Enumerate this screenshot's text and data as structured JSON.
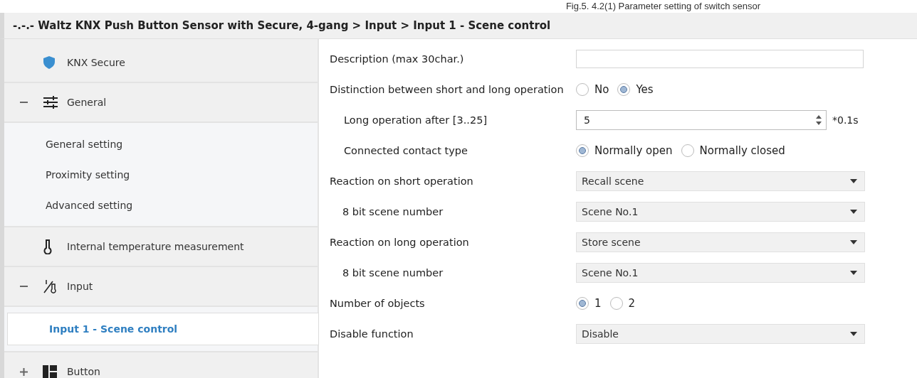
{
  "caption": "Fig.5. 4.2(1) Parameter setting of switch sensor",
  "title": "-.-.- Waltz KNX Push Button Sensor with Secure, 4-gang > Input > Input 1 - Scene control",
  "sidebar": {
    "items": [
      {
        "label": "KNX Secure"
      },
      {
        "label": "General",
        "expanded": true,
        "children": [
          {
            "label": "General setting",
            "selected": false
          },
          {
            "label": "Proximity setting",
            "selected": false
          },
          {
            "label": "Advanced setting",
            "selected": false
          }
        ]
      },
      {
        "label": "Internal temperature measurement"
      },
      {
        "label": "Input",
        "expanded": true,
        "children": [
          {
            "label": "Input 1 - Scene control",
            "selected": true
          }
        ]
      },
      {
        "label": "Button",
        "expanded": false
      }
    ]
  },
  "parameters": [
    {
      "kind": "text",
      "label": "Description (max 30char.)"
    },
    {
      "kind": "radio",
      "label": "Distinction between short and long operation",
      "options": [
        {
          "label": "No",
          "selected": false
        },
        {
          "label": "Yes",
          "selected": true
        }
      ],
      "children": [
        {
          "kind": "spin",
          "label": "Long operation after [3..25]",
          "value": "5",
          "unit": "*0.1s"
        },
        {
          "kind": "radio",
          "label": "Connected contact type",
          "options": [
            {
              "label": "Normally open",
              "selected": true
            },
            {
              "label": "Normally closed",
              "selected": false
            }
          ]
        }
      ]
    },
    {
      "kind": "dropdown",
      "label": "Reaction on short operation",
      "value": "Recall scene",
      "children": [
        {
          "kind": "dropdown",
          "label": "8 bit scene number",
          "value": "Scene No.1"
        }
      ]
    },
    {
      "kind": "dropdown",
      "label": "Reaction on long operation",
      "value": "Store scene",
      "children": [
        {
          "kind": "dropdown",
          "label": "8 bit scene number",
          "value": "Scene No.1"
        }
      ]
    },
    {
      "kind": "radio",
      "label": "Number of objects",
      "options": [
        {
          "label": "1",
          "selected": true
        },
        {
          "label": "2",
          "selected": false
        }
      ]
    },
    {
      "kind": "dropdown",
      "label": "Disable function",
      "value": "Disable"
    }
  ]
}
